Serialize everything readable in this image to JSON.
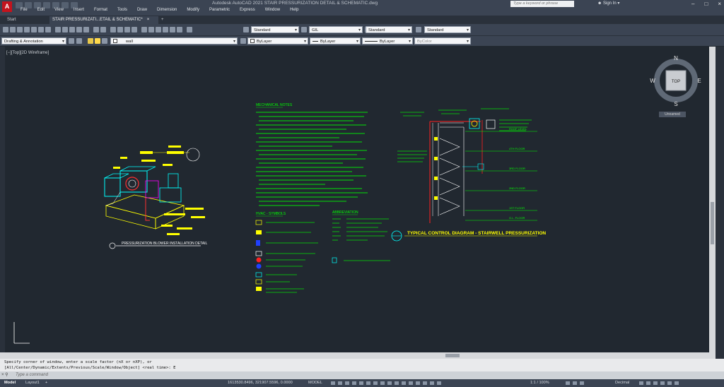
{
  "app": {
    "logo": "A",
    "window_title": "Autodesk AutoCAD 2021    STAIR PRESSURIZATION DETAIL & SCHEMATIC.dwg",
    "search_placeholder": "Type a keyword or phrase",
    "signin": "Sign In"
  },
  "menu": [
    "File",
    "Edit",
    "View",
    "Insert",
    "Format",
    "Tools",
    "Draw",
    "Dimension",
    "Modify",
    "Parametric",
    "Express",
    "Window",
    "Help"
  ],
  "tabs": {
    "start": "Start",
    "doc": "STAIR PRESSURIZATI...ETAIL & SCHEMATIC*",
    "plus": "+"
  },
  "toolbar": {
    "text_style": "Standard",
    "dim_style": "GIL",
    "table_style": "Standard",
    "mleader_style": "Standard",
    "workspace": "Drafting & Annotation",
    "layer": "wall",
    "color": "ByLayer",
    "linetype": "ByLayer",
    "lineweight": "ByLayer",
    "plotstyle": "ByColor"
  },
  "viewport_label": "[−][Top][2D Wireframe]",
  "viewcube": {
    "n": "N",
    "s": "S",
    "e": "E",
    "w": "W",
    "top": "TOP",
    "ucs": "Unnamed"
  },
  "drawing": {
    "left_title": "PRESSURIZATION BLOWER INSTALLATION DETAIL",
    "mech_notes_title": "MECHANICAL NOTES",
    "hvac_title": "HVAC - SYMBOLS",
    "abbr_title": "ABBREVIATION",
    "right_title": "TYPICAL CONTROL DIAGRAM - STAIRWELL PRESSURIZATION",
    "floors": [
      "ROOF LEVEL",
      "4TH FLOOR",
      "3RD FLOOR",
      "2ND FLOOR",
      "1ST FLOOR",
      "G.L. FLOOR"
    ]
  },
  "command": {
    "history1": "Specify corner of window, enter a scale factor (nX or nXP), or",
    "history2": "[All/Center/Dynamic/Extents/Previous/Scale/Window/Object] <real time>: E",
    "placeholder": "Type a command"
  },
  "status": {
    "model_tab": "Model",
    "layout_tab": "Layout1",
    "coords": "1613530.8496, 321907.5596, 0.0000",
    "space": "MODEL",
    "scale": "1:1 / 100%",
    "units": "Decimal"
  },
  "colors": {
    "accent": "#ffff00",
    "line_cyan": "#00ffff",
    "line_green": "#00ff00",
    "line_red": "#ff2020",
    "canvas": "#212830"
  }
}
